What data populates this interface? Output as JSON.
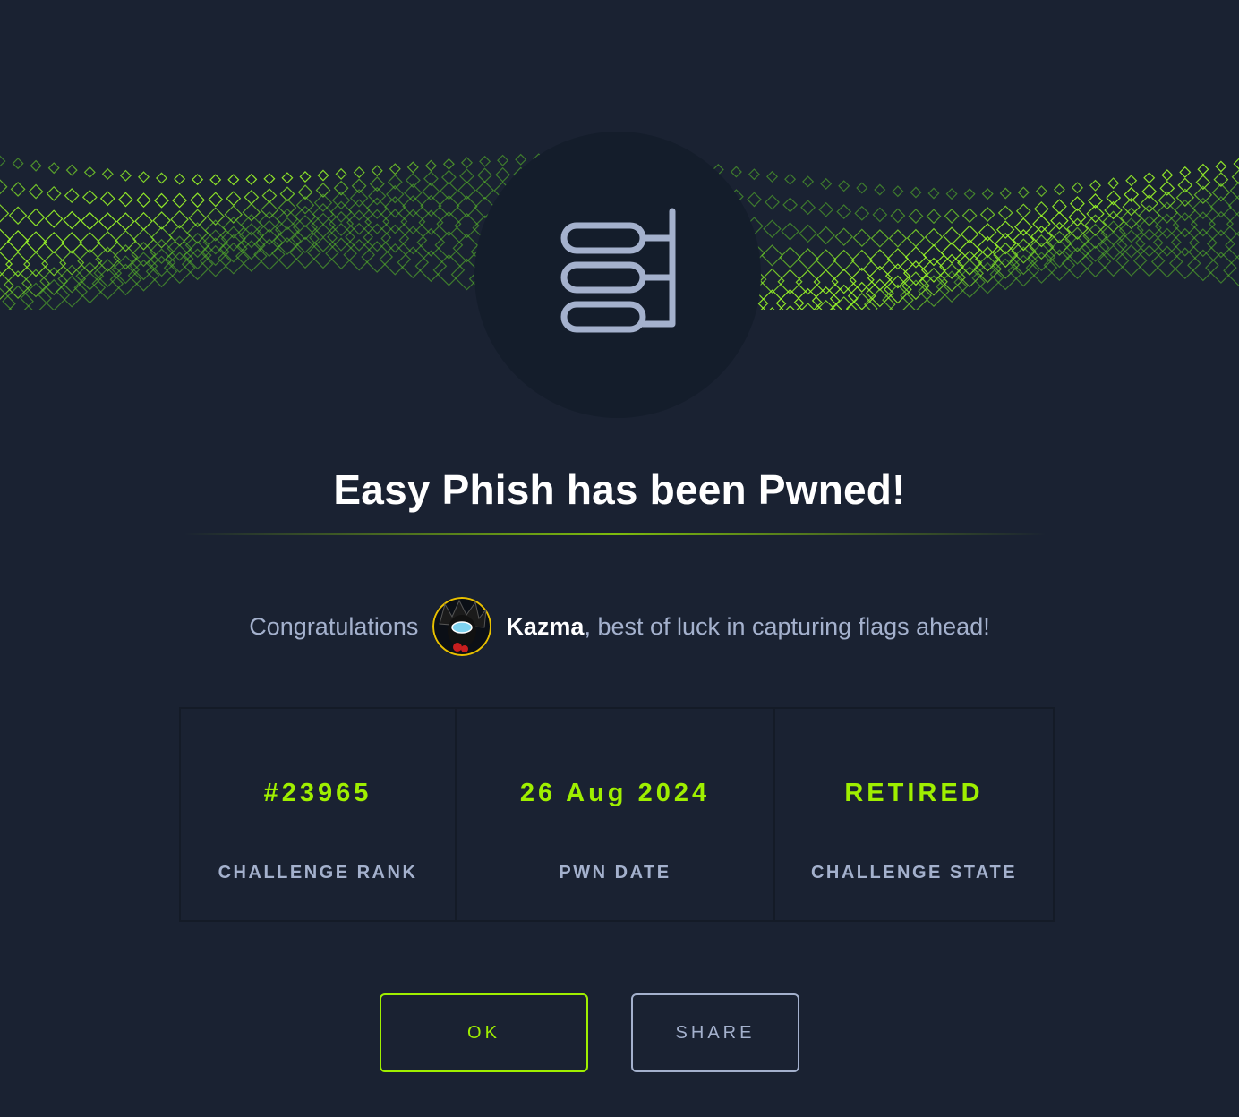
{
  "modal": {
    "title": "Easy Phish has been Pwned!",
    "congrats_prefix": "Congratulations",
    "username": "Kazma",
    "congrats_suffix": ", best of luck in capturing flags ahead!",
    "badge_icon": "database-stack-icon",
    "avatar_icon": "user-avatar"
  },
  "stats": [
    {
      "value": "#23965",
      "label": "CHALLENGE RANK"
    },
    {
      "value": "26 Aug 2024",
      "label": "PWN DATE"
    },
    {
      "value": "RETIRED",
      "label": "CHALLENGE STATE"
    }
  ],
  "buttons": {
    "ok_label": "OK",
    "share_label": "SHARE"
  },
  "colors": {
    "background": "#1a2232",
    "accent": "#9fef00",
    "muted_text": "#a4b1cd",
    "badge": "#141d2b"
  }
}
